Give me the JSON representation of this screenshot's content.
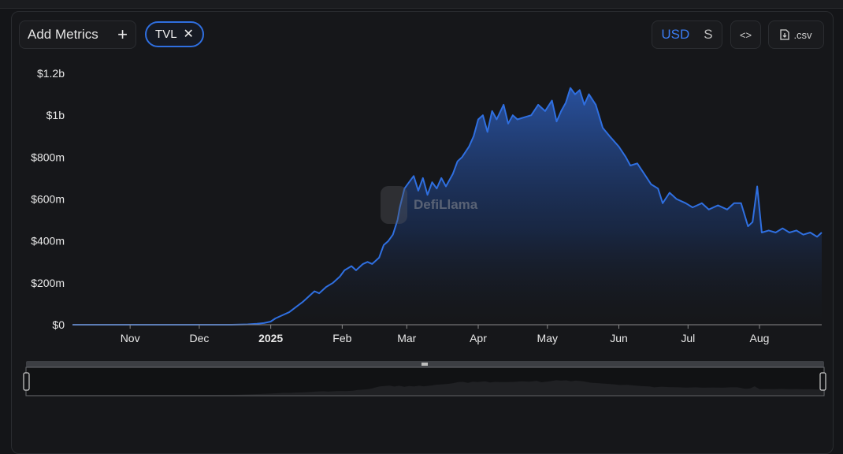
{
  "toolbar": {
    "add_metrics_label": "Add Metrics",
    "add_icon": "plus-icon",
    "metric_chip_label": "TVL",
    "remove_icon": "close-icon",
    "currency_primary": "USD",
    "currency_secondary": "S",
    "embed_icon": "code-icon",
    "csv_icon": "download-icon",
    "csv_label": ".csv"
  },
  "watermark": "DefiLlama",
  "colors": {
    "background": "#141518",
    "line": "#2f6fe0",
    "accent": "#3a7bf0"
  },
  "chart_data": {
    "type": "area",
    "title": "",
    "xlabel": "",
    "ylabel": "",
    "ylim": [
      0,
      1200000000
    ],
    "y_ticks": [
      "$0",
      "$200m",
      "$400m",
      "$600m",
      "$800m",
      "$1b",
      "$1.2b"
    ],
    "x_ticks": [
      "Nov",
      "Dec",
      "2025",
      "Feb",
      "Mar",
      "Apr",
      "May",
      "Jun",
      "Jul",
      "Aug"
    ],
    "x_range": [
      "2024-10-07",
      "2025-08-28"
    ],
    "grid": false,
    "series": [
      {
        "values": [
          [
            "2024-10-07",
            0
          ],
          [
            "2024-11-15",
            0
          ],
          [
            "2024-12-15",
            0
          ],
          [
            "2024-12-22",
            2000000
          ],
          [
            "2024-12-26",
            5000000
          ],
          [
            "2024-12-29",
            8000000
          ],
          [
            "2025-01-01",
            15000000
          ],
          [
            "2025-01-03",
            30000000
          ],
          [
            "2025-01-06",
            45000000
          ],
          [
            "2025-01-09",
            60000000
          ],
          [
            "2025-01-12",
            85000000
          ],
          [
            "2025-01-15",
            110000000
          ],
          [
            "2025-01-18",
            140000000
          ],
          [
            "2025-01-20",
            160000000
          ],
          [
            "2025-01-22",
            150000000
          ],
          [
            "2025-01-25",
            180000000
          ],
          [
            "2025-01-28",
            200000000
          ],
          [
            "2025-01-31",
            230000000
          ],
          [
            "2025-02-02",
            260000000
          ],
          [
            "2025-02-05",
            280000000
          ],
          [
            "2025-02-07",
            260000000
          ],
          [
            "2025-02-10",
            290000000
          ],
          [
            "2025-02-12",
            300000000
          ],
          [
            "2025-02-14",
            290000000
          ],
          [
            "2025-02-17",
            320000000
          ],
          [
            "2025-02-19",
            380000000
          ],
          [
            "2025-02-21",
            400000000
          ],
          [
            "2025-02-23",
            430000000
          ],
          [
            "2025-02-25",
            500000000
          ],
          [
            "2025-02-26",
            560000000
          ],
          [
            "2025-02-28",
            650000000
          ],
          [
            "2025-03-02",
            680000000
          ],
          [
            "2025-03-04",
            710000000
          ],
          [
            "2025-03-06",
            640000000
          ],
          [
            "2025-03-08",
            700000000
          ],
          [
            "2025-03-10",
            620000000
          ],
          [
            "2025-03-12",
            680000000
          ],
          [
            "2025-03-14",
            650000000
          ],
          [
            "2025-03-16",
            700000000
          ],
          [
            "2025-03-18",
            660000000
          ],
          [
            "2025-03-21",
            720000000
          ],
          [
            "2025-03-23",
            780000000
          ],
          [
            "2025-03-25",
            800000000
          ],
          [
            "2025-03-28",
            850000000
          ],
          [
            "2025-03-30",
            900000000
          ],
          [
            "2025-04-01",
            980000000
          ],
          [
            "2025-04-03",
            1000000000
          ],
          [
            "2025-04-05",
            920000000
          ],
          [
            "2025-04-07",
            1020000000
          ],
          [
            "2025-04-09",
            980000000
          ],
          [
            "2025-04-12",
            1050000000
          ],
          [
            "2025-04-14",
            960000000
          ],
          [
            "2025-04-16",
            1000000000
          ],
          [
            "2025-04-18",
            980000000
          ],
          [
            "2025-04-21",
            990000000
          ],
          [
            "2025-04-24",
            1000000000
          ],
          [
            "2025-04-27",
            1050000000
          ],
          [
            "2025-04-30",
            1020000000
          ],
          [
            "2025-05-03",
            1070000000
          ],
          [
            "2025-05-05",
            970000000
          ],
          [
            "2025-05-07",
            1020000000
          ],
          [
            "2025-05-09",
            1060000000
          ],
          [
            "2025-05-11",
            1130000000
          ],
          [
            "2025-05-13",
            1100000000
          ],
          [
            "2025-05-15",
            1120000000
          ],
          [
            "2025-05-17",
            1050000000
          ],
          [
            "2025-05-19",
            1100000000
          ],
          [
            "2025-05-22",
            1050000000
          ],
          [
            "2025-05-25",
            940000000
          ],
          [
            "2025-05-28",
            900000000
          ],
          [
            "2025-06-01",
            850000000
          ],
          [
            "2025-06-04",
            800000000
          ],
          [
            "2025-06-06",
            760000000
          ],
          [
            "2025-06-09",
            770000000
          ],
          [
            "2025-06-12",
            720000000
          ],
          [
            "2025-06-15",
            670000000
          ],
          [
            "2025-06-18",
            650000000
          ],
          [
            "2025-06-20",
            580000000
          ],
          [
            "2025-06-23",
            630000000
          ],
          [
            "2025-06-26",
            600000000
          ],
          [
            "2025-06-30",
            580000000
          ],
          [
            "2025-07-03",
            560000000
          ],
          [
            "2025-07-07",
            580000000
          ],
          [
            "2025-07-10",
            550000000
          ],
          [
            "2025-07-14",
            570000000
          ],
          [
            "2025-07-18",
            550000000
          ],
          [
            "2025-07-21",
            580000000
          ],
          [
            "2025-07-24",
            580000000
          ],
          [
            "2025-07-27",
            470000000
          ],
          [
            "2025-07-29",
            490000000
          ],
          [
            "2025-07-31",
            660000000
          ],
          [
            "2025-08-02",
            440000000
          ],
          [
            "2025-08-05",
            450000000
          ],
          [
            "2025-08-08",
            440000000
          ],
          [
            "2025-08-11",
            460000000
          ],
          [
            "2025-08-14",
            440000000
          ],
          [
            "2025-08-17",
            450000000
          ],
          [
            "2025-08-20",
            430000000
          ],
          [
            "2025-08-23",
            440000000
          ],
          [
            "2025-08-26",
            420000000
          ],
          [
            "2025-08-28",
            440000000
          ]
        ]
      }
    ]
  }
}
